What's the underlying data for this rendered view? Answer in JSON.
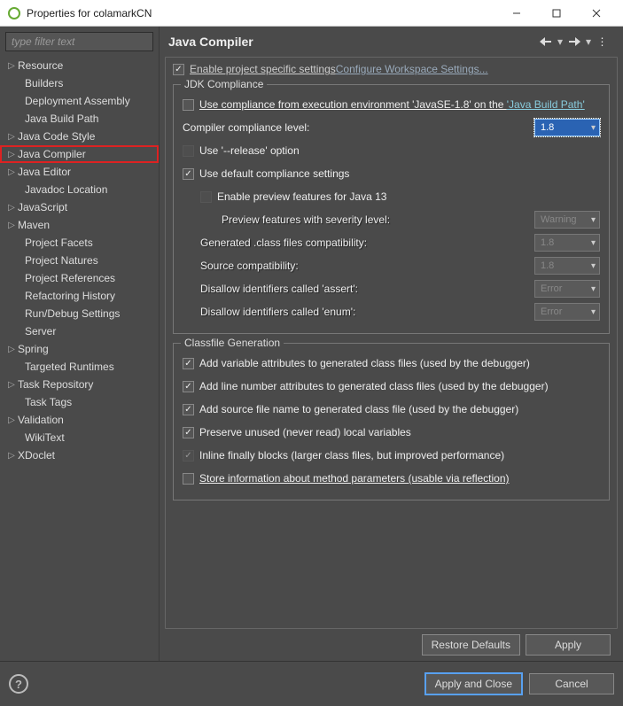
{
  "window": {
    "title": "Properties for colamarkCN"
  },
  "sidebar": {
    "filter_placeholder": "type filter text",
    "items": [
      {
        "label": "Resource",
        "exp": true,
        "child": false
      },
      {
        "label": "Builders",
        "exp": false,
        "child": true
      },
      {
        "label": "Deployment Assembly",
        "exp": false,
        "child": true
      },
      {
        "label": "Java Build Path",
        "exp": false,
        "child": true
      },
      {
        "label": "Java Code Style",
        "exp": true,
        "child": false
      },
      {
        "label": "Java Compiler",
        "exp": true,
        "child": false,
        "selected": true
      },
      {
        "label": "Java Editor",
        "exp": true,
        "child": false
      },
      {
        "label": "Javadoc Location",
        "exp": false,
        "child": true
      },
      {
        "label": "JavaScript",
        "exp": true,
        "child": false
      },
      {
        "label": "Maven",
        "exp": true,
        "child": false
      },
      {
        "label": "Project Facets",
        "exp": false,
        "child": true
      },
      {
        "label": "Project Natures",
        "exp": false,
        "child": true
      },
      {
        "label": "Project References",
        "exp": false,
        "child": true
      },
      {
        "label": "Refactoring History",
        "exp": false,
        "child": true
      },
      {
        "label": "Run/Debug Settings",
        "exp": false,
        "child": true
      },
      {
        "label": "Server",
        "exp": false,
        "child": true
      },
      {
        "label": "Spring",
        "exp": true,
        "child": false
      },
      {
        "label": "Targeted Runtimes",
        "exp": false,
        "child": true
      },
      {
        "label": "Task Repository",
        "exp": true,
        "child": false
      },
      {
        "label": "Task Tags",
        "exp": false,
        "child": true
      },
      {
        "label": "Validation",
        "exp": true,
        "child": false
      },
      {
        "label": "WikiText",
        "exp": false,
        "child": true
      },
      {
        "label": "XDoclet",
        "exp": true,
        "child": false
      }
    ]
  },
  "page": {
    "heading": "Java Compiler",
    "enable_project_specific": "Enable project specific settings",
    "configure_link": "Configure Workspace Settings...",
    "jdk": {
      "group": "JDK Compliance",
      "use_compliance_from_env_pre": "Use compliance from execution environment 'JavaSE-1.8' on the ",
      "java_build_path_link": "'Java Build Path'",
      "compiler_level_label": "Compiler compliance level:",
      "compiler_level_value": "1.8",
      "use_release": "Use '--release' option",
      "use_default": "Use default compliance settings",
      "enable_preview": "Enable preview features for Java 13",
      "preview_severity_label": "Preview features with severity level:",
      "preview_severity_value": "Warning",
      "generated_compat_label": "Generated .class files compatibility:",
      "generated_compat_value": "1.8",
      "source_compat_label": "Source compatibility:",
      "source_compat_value": "1.8",
      "disallow_assert_label": "Disallow identifiers called 'assert':",
      "disallow_assert_value": "Error",
      "disallow_enum_label": "Disallow identifiers called 'enum':",
      "disallow_enum_value": "Error"
    },
    "classfile": {
      "group": "Classfile Generation",
      "add_var": "Add variable attributes to generated class files (used by the debugger)",
      "add_line": "Add line number attributes to generated class files (used by the debugger)",
      "add_source": "Add source file name to generated class file (used by the debugger)",
      "preserve_unused": "Preserve unused (never read) local variables",
      "inline_finally": "Inline finally blocks (larger class files, but improved performance)",
      "store_method_params": "Store information about method parameters (usable via reflection)"
    },
    "buttons": {
      "restore": "Restore Defaults",
      "apply": "Apply",
      "apply_close": "Apply and Close",
      "cancel": "Cancel"
    }
  }
}
